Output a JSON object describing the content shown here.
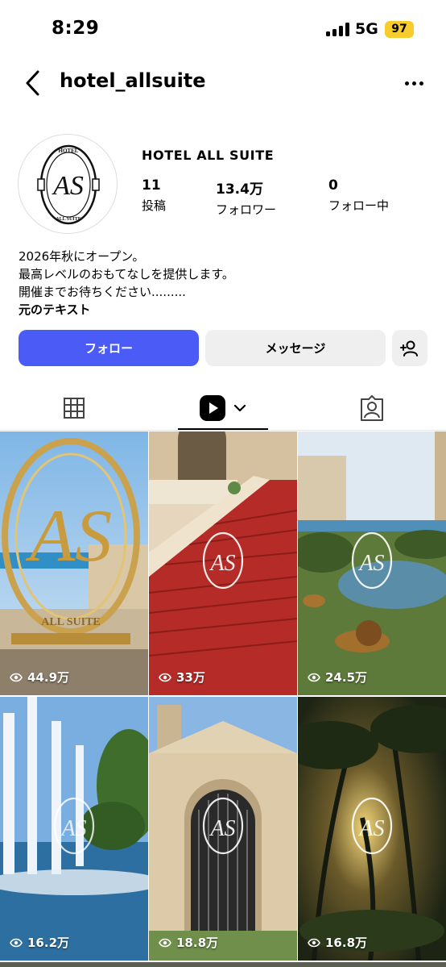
{
  "status_bar": {
    "time": "8:29",
    "network": "5G",
    "battery": "97",
    "battery_color": "#f7cc2d"
  },
  "header": {
    "username": "hotel_allsuite",
    "back_icon": "chevron-left-icon",
    "more_icon": "more-horizontal-icon"
  },
  "profile": {
    "display_name": "HOTEL ALL SUITE",
    "avatar_logo_text": [
      "HOTEL",
      "AS",
      "ALL SUITE"
    ],
    "stats": [
      {
        "value": "11",
        "label": "投稿"
      },
      {
        "value": "13.4万",
        "label": "フォロワー"
      },
      {
        "value": "0",
        "label": "フォロー中"
      }
    ],
    "bio_lines": [
      "2026年秋にオープン。",
      "最高レベルのおもてなしを提供します。",
      "開催までお待ちください........."
    ],
    "translate_link": "元のテキスト"
  },
  "actions": {
    "follow_label": "フォロー",
    "message_label": "メッセージ",
    "add_person_icon": "add-person-icon",
    "follow_color": "#4a5cf5"
  },
  "tabs": [
    {
      "name": "grid",
      "icon": "grid-icon"
    },
    {
      "name": "reels",
      "icon": "reels-icon",
      "active": true
    },
    {
      "name": "tagged",
      "icon": "tagged-person-icon"
    }
  ],
  "posts": [
    {
      "views": "44.9万",
      "scene": "golden AS logo sign over resort"
    },
    {
      "views": "33万",
      "scene": "red carpet grand staircase"
    },
    {
      "views": "24.5万",
      "scene": "lions by lagoon"
    },
    {
      "views": "16.2万",
      "scene": "fountains with palms"
    },
    {
      "views": "18.8万",
      "scene": "ornate gate entrance"
    },
    {
      "views": "16.8万",
      "scene": "sunlit palm jungle"
    }
  ]
}
